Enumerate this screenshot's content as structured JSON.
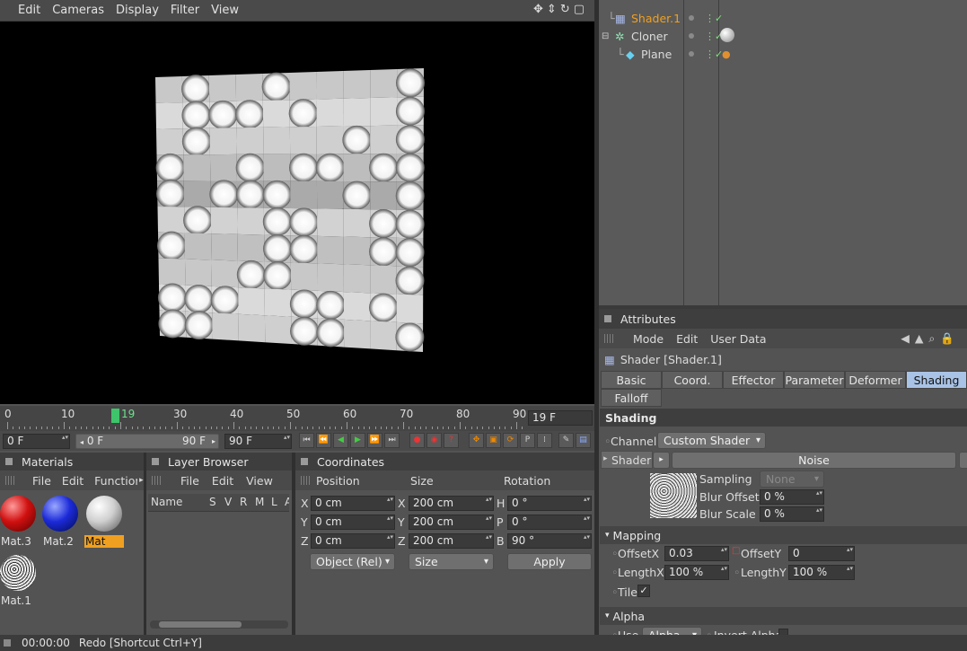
{
  "menu": [
    "Edit",
    "Cameras",
    "Display",
    "Filter",
    "View"
  ],
  "objects": [
    {
      "name": "Shader.1",
      "active": true
    },
    {
      "name": "Cloner",
      "active": false
    },
    {
      "name": "Plane",
      "active": false
    }
  ],
  "attributes": {
    "panel_title": "Attributes",
    "menu": [
      "Mode",
      "Edit",
      "User Data"
    ],
    "object_title": "Shader [Shader.1]",
    "tabs": [
      "Basic",
      "Coord.",
      "Effector",
      "Parameter",
      "Deformer",
      "Shading"
    ],
    "tab_falloff": "Falloff",
    "active_tab": "Shading",
    "shading_header": "Shading",
    "channel_label": "Channel",
    "channel_value": "Custom Shader",
    "shader_label": "Shader",
    "shader_value": "Noise",
    "sampling_label": "Sampling",
    "sampling_value": "None",
    "blur_offset_label": "Blur Offset",
    "blur_offset_value": "0 %",
    "blur_scale_label": "Blur Scale",
    "blur_scale_value": "0 %",
    "mapping_header": "Mapping",
    "offsetx_label": "OffsetX",
    "offsetx_value": "0.03",
    "offsety_label": "OffsetY",
    "offsety_value": "0",
    "lengthx_label": "LengthX",
    "lengthx_value": "100 %",
    "lengthy_label": "LengthY",
    "lengthy_value": "100 %",
    "tile_label": "Tile",
    "alpha_header": "Alpha",
    "use_label": "Use",
    "use_value": "Alpha",
    "invert_alpha_label": "Invert Alpha"
  },
  "timeline": {
    "ticks": [
      "0",
      "10",
      "19",
      "30",
      "40",
      "50",
      "60",
      "70",
      "80",
      "90"
    ],
    "current_frame": 19,
    "frame_field": "19 F",
    "start_field": "0 F",
    "range_start": "0 F",
    "range_end": "90 F",
    "end_field": "90 F"
  },
  "materials": {
    "title": "Materials",
    "menu": [
      "File",
      "Edit",
      "Function"
    ],
    "items": [
      {
        "name": "Mat.3",
        "color": "#d01010"
      },
      {
        "name": "Mat.2",
        "color": "#1c2ad8"
      },
      {
        "name": "Mat",
        "color": "#cfcfcf",
        "selected": true
      },
      {
        "name": "Mat.1",
        "color": "noise"
      }
    ]
  },
  "layer_browser": {
    "title": "Layer Browser",
    "menu": [
      "File",
      "Edit",
      "View"
    ],
    "columns": [
      "Name",
      "S",
      "V",
      "R",
      "M",
      "L",
      "A"
    ]
  },
  "coordinates": {
    "title": "Coordinates",
    "headers": [
      "Position",
      "Size",
      "Rotation"
    ],
    "rows": [
      {
        "axis": "X",
        "pos": "0 cm",
        "size_axis": "X",
        "size": "200 cm",
        "rot_axis": "H",
        "rot": "0 °"
      },
      {
        "axis": "Y",
        "pos": "0 cm",
        "size_axis": "Y",
        "size": "200 cm",
        "rot_axis": "P",
        "rot": "0 °"
      },
      {
        "axis": "Z",
        "pos": "0 cm",
        "size_axis": "Z",
        "size": "200 cm",
        "rot_axis": "B",
        "rot": "90 °"
      }
    ],
    "mode": "Object (Rel)",
    "size_mode": "Size",
    "apply": "Apply"
  },
  "status": {
    "time": "00:00:00",
    "message": "Redo [Shortcut Ctrl+Y]"
  },
  "colors": {
    "accent_orange": "#f0a020",
    "tab_active": "#a9c3e6",
    "timeline_marker": "#3ec46a"
  }
}
